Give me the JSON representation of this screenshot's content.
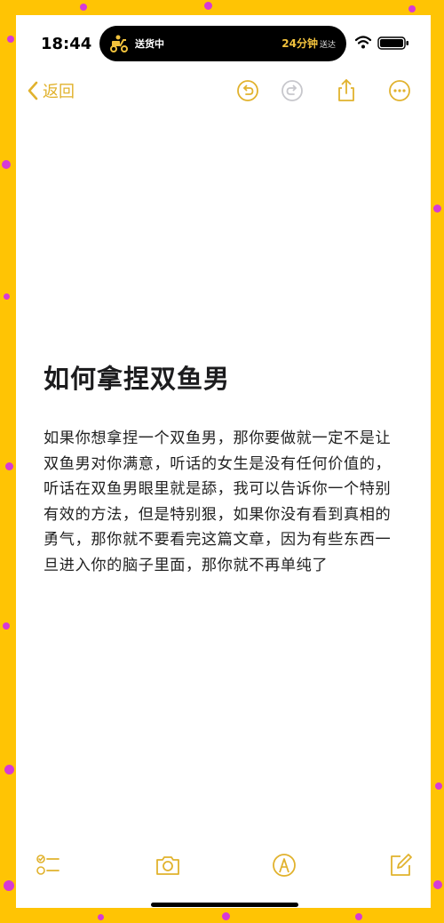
{
  "status_bar": {
    "time": "18:44",
    "activity_status": "送货中",
    "eta": "24分钟",
    "eta_suffix": "送达"
  },
  "toolbar": {
    "back_label": "返回",
    "buttons": [
      "undo-icon",
      "redo-icon",
      "share-icon",
      "more-icon"
    ]
  },
  "note": {
    "title": "如何拿捏双鱼男",
    "body": "如果你想拿捏一个双鱼男，那你要做就一定不是让双鱼男对你满意，听话的女生是没有任何价值的，听话在双鱼男眼里就是舔，我可以告诉你一个特别有效的方法，但是特别狠，如果你没有看到真相的勇气，那你就不要看完这篇文章，因为有些东西一旦进入你的脑子里面，那你就不再单纯了"
  },
  "bottom_toolbar": {
    "buttons": [
      "checklist-icon",
      "camera-icon",
      "markup-icon",
      "compose-icon"
    ]
  },
  "colors": {
    "accent": "#E1B22D",
    "background_frame": "#FFC404",
    "dots": "#D63AD6"
  }
}
